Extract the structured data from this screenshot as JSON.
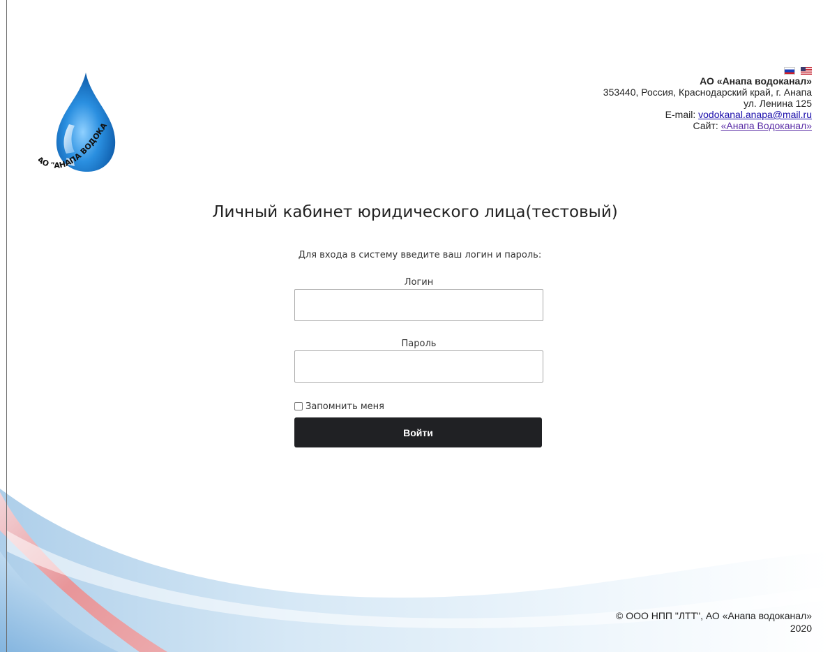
{
  "header": {
    "company_name": "АО «Анапа водоканал»",
    "address_line1": "353440, Россия, Краснодарский край, г. Анапа",
    "address_line2": "ул. Ленина 125",
    "email_label": "E-mail: ",
    "email_link": "vodokanal.anapa@mail.ru",
    "site_label": "Сайт: ",
    "site_link": "«Анапа Водоканал»",
    "flags": [
      "flag-ru-icon",
      "flag-us-icon"
    ]
  },
  "logo": {
    "text": "АО \"АНАПА ВОДОКАНАЛ\""
  },
  "main": {
    "title": "Личный кабинет юридического лица(тестовый)",
    "instructions": "Для входа в систему введите ваш логин и пароль:",
    "login_label": "Логин",
    "login_value": "",
    "password_label": "Пароль",
    "password_value": "",
    "remember_label": "Запомнить меня",
    "remember_checked": false,
    "submit_label": "Войти"
  },
  "footer": {
    "copyright": "© ООО НПП \"ЛТТ\", АО «Анапа водоканал»",
    "year": "2020"
  },
  "colors": {
    "button_bg": "#202124",
    "link": "#1a0dab",
    "wave_blue": "#bcd9ef",
    "wave_red": "#e84a4a",
    "drop_blue": "#1f7fd6"
  }
}
